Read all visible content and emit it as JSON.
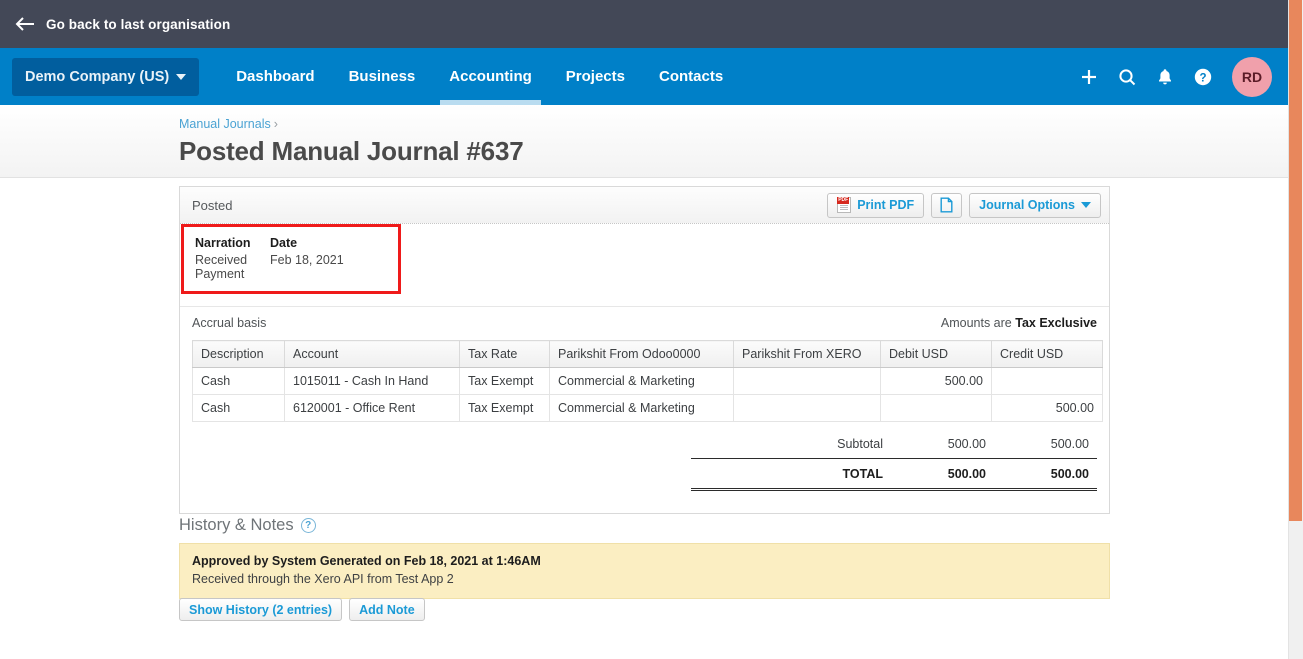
{
  "topbar": {
    "back_label": "Go back to last organisation",
    "back_icon": "arrow-left-icon"
  },
  "nav": {
    "org_name": "Demo Company (US)",
    "items": [
      {
        "label": "Dashboard",
        "active": false
      },
      {
        "label": "Business",
        "active": false
      },
      {
        "label": "Accounting",
        "active": true
      },
      {
        "label": "Projects",
        "active": false
      },
      {
        "label": "Contacts",
        "active": false
      }
    ],
    "icons": [
      "plus-icon",
      "search-icon",
      "bell-icon",
      "help-icon"
    ],
    "avatar_initials": "RD",
    "accent_blue": "#0080c8",
    "org_chip_blue": "#015e9e",
    "avatar_pink": "#f0a0ab"
  },
  "heading": {
    "breadcrumb_link": "Manual Journals",
    "breadcrumb_separator": "›",
    "title": "Posted Manual Journal #637"
  },
  "panel": {
    "status": "Posted",
    "print_pdf_label": "Print PDF",
    "print_pdf_icon": "pdf-file-icon",
    "attachment_icon": "attachment-page-icon",
    "journal_options_label": "Journal Options",
    "narration_label": "Narration",
    "narration_value": "Received Payment",
    "date_label": "Date",
    "date_value": "Feb 18, 2021",
    "basis_label": "Accrual basis",
    "amounts_are_prefix": "Amounts are",
    "amounts_are_value": "Tax Exclusive",
    "highlight_color": "#ef1a1a"
  },
  "table": {
    "columns": [
      "Description",
      "Account",
      "Tax Rate",
      "Parikshit From Odoo0000",
      "Parikshit From XERO",
      "Debit USD",
      "Credit USD"
    ],
    "rows": [
      {
        "description": "Cash",
        "account": "1015011 - Cash In Hand",
        "tax_rate": "Tax Exempt",
        "odoo": "Commercial & Marketing",
        "xero": "",
        "debit": "500.00",
        "credit": ""
      },
      {
        "description": "Cash",
        "account": "6120001 - Office Rent",
        "tax_rate": "Tax Exempt",
        "odoo": "Commercial & Marketing",
        "xero": "",
        "debit": "",
        "credit": "500.00"
      }
    ],
    "subtotal_label": "Subtotal",
    "subtotal_debit": "500.00",
    "subtotal_credit": "500.00",
    "total_label": "TOTAL",
    "total_debit": "500.00",
    "total_credit": "500.00"
  },
  "history": {
    "title": "History & Notes",
    "help_icon": "question-mark-icon",
    "note_title": "Approved by System Generated on Feb 18, 2021 at 1:46AM",
    "note_body": "Received through the Xero API from Test App 2",
    "show_history_label": "Show History (2 entries)",
    "add_note_label": "Add Note",
    "note_bg": "#fbeec2"
  },
  "scrollbar": {
    "thumb_color": "#e8875c"
  }
}
